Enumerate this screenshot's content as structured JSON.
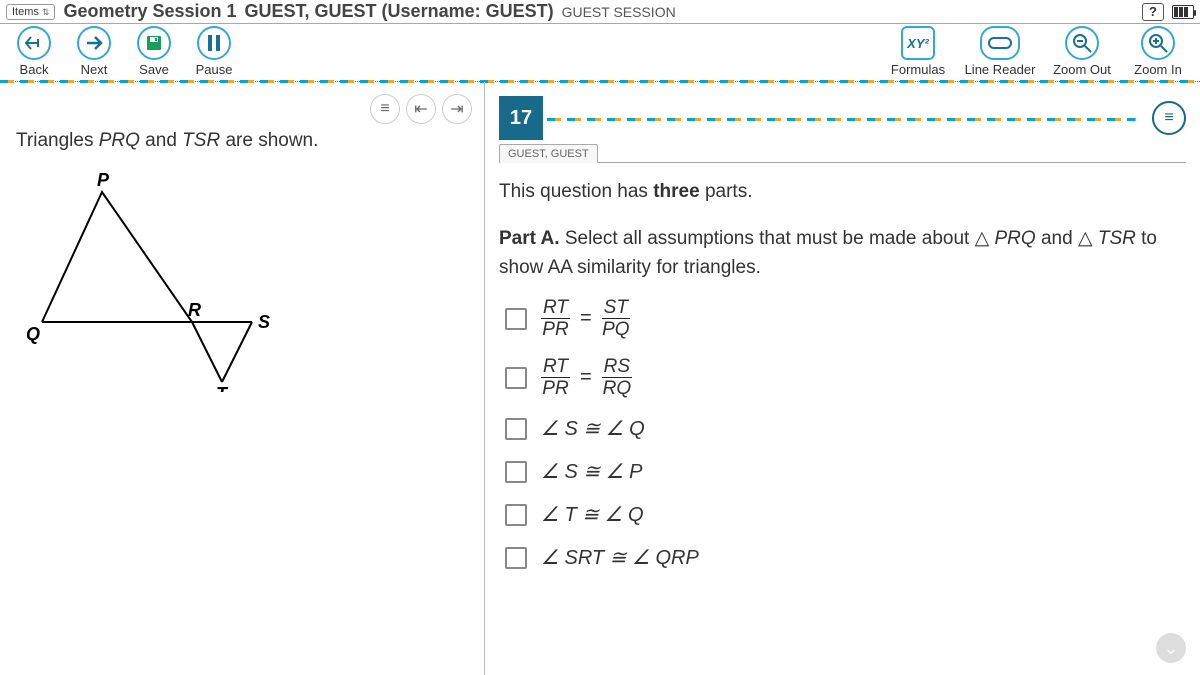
{
  "topbar": {
    "items_label": "Items",
    "session_title": "Geometry Session 1",
    "user_info": "GUEST, GUEST (Username: GUEST)",
    "session_mode": "GUEST SESSION",
    "help": "?"
  },
  "toolbar": {
    "back": "Back",
    "next": "Next",
    "save": "Save",
    "pause": "Pause",
    "formulas": "Formulas",
    "formulas_icon": "XY²",
    "line_reader": "Line Reader",
    "zoom_out": "Zoom Out",
    "zoom_in": "Zoom In"
  },
  "stimulus": {
    "text_before": "Triangles ",
    "tri1": "PRQ",
    "text_mid": " and ",
    "tri2": "TSR",
    "text_after": " are shown.",
    "labels": {
      "P": "P",
      "Q": "Q",
      "R": "R",
      "S": "S",
      "T": "T"
    }
  },
  "question": {
    "number": "17",
    "tab_user": "GUEST, GUEST",
    "intro_before": "This question has ",
    "intro_bold": "three",
    "intro_after": " parts.",
    "partA_label": "Part A.",
    "partA_text1": " Select all assumptions that must be made about  ",
    "partA_tri1": "PRQ",
    "partA_text2": " and ",
    "partA_tri2": "TSR",
    "partA_text3": " to show AA similarity for triangles.",
    "options": {
      "o1": {
        "n1": "RT",
        "d1": "PR",
        "n2": "ST",
        "d2": "PQ"
      },
      "o2": {
        "n1": "RT",
        "d1": "PR",
        "n2": "RS",
        "d2": "RQ"
      },
      "o3": "∠ S ≅ ∠ Q",
      "o4": "∠ S ≅ ∠ P",
      "o5": "∠ T ≅ ∠ Q",
      "o6": "∠ SRT ≅ ∠ QRP"
    }
  }
}
